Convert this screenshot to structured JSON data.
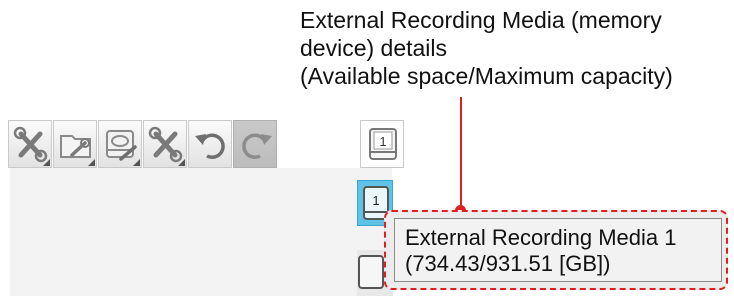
{
  "callout": {
    "line1": "External Recording Media (memory",
    "line2": "device) details",
    "line3": "(Available space/Maximum capacity)"
  },
  "toolbar": {
    "buttons": [
      {
        "name": "tools-icon"
      },
      {
        "name": "folder-settings-icon"
      },
      {
        "name": "disk-settings-icon"
      },
      {
        "name": "tools-icon"
      },
      {
        "name": "undo-icon"
      },
      {
        "name": "redo-icon",
        "state": "disabled"
      },
      {
        "name": "recording-media-1-icon",
        "label": "1"
      }
    ]
  },
  "media_list": {
    "selected_label": "1"
  },
  "tooltip": {
    "title": "External Recording Media 1",
    "capacity": "(734.43/931.51 [GB])"
  },
  "colors": {
    "annotation": "#e02020",
    "selected": "#5fc3e8"
  }
}
